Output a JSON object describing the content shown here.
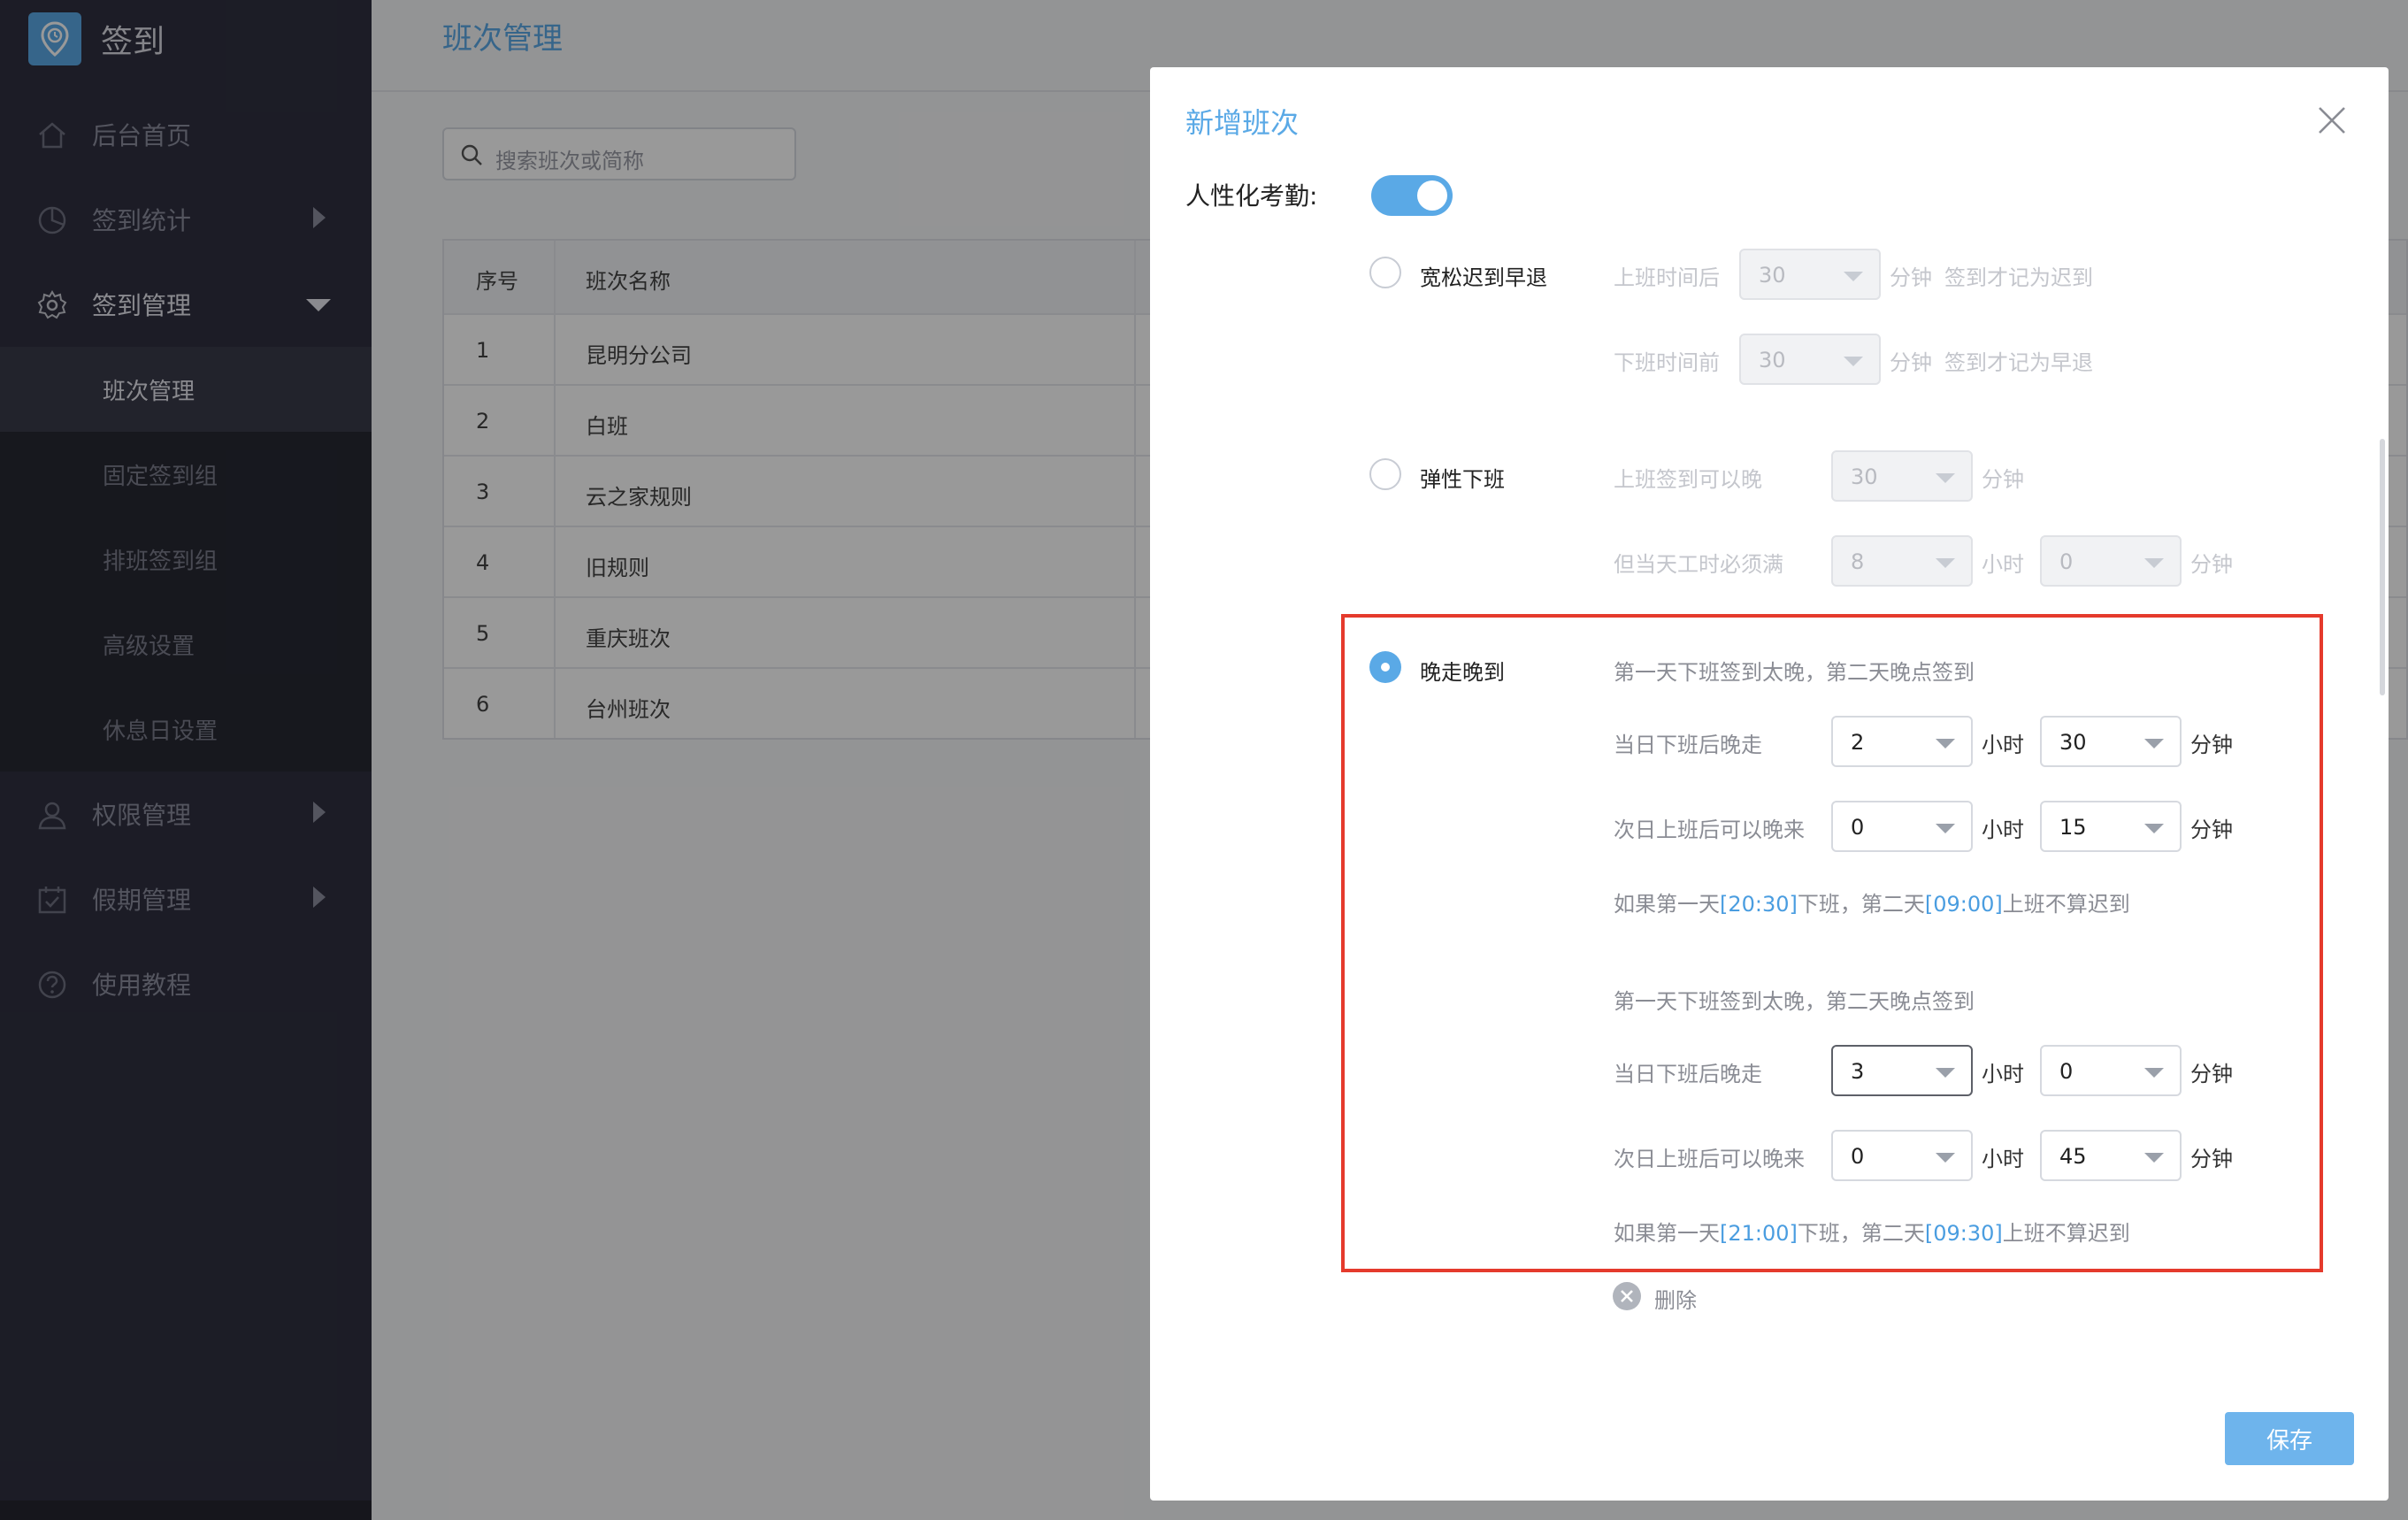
{
  "app": {
    "logo_text": "签到"
  },
  "sidebar": {
    "items": [
      {
        "label": "后台首页",
        "icon": "home-icon"
      },
      {
        "label": "签到统计",
        "icon": "pie-chart-icon"
      },
      {
        "label": "签到管理",
        "icon": "gear-icon"
      },
      {
        "label": "权限管理",
        "icon": "user-icon"
      },
      {
        "label": "假期管理",
        "icon": "calendar-check-icon"
      },
      {
        "label": "使用教程",
        "icon": "help-icon"
      }
    ],
    "submenu": [
      "班次管理",
      "固定签到组",
      "排班签到组",
      "高级设置",
      "休息日设置"
    ]
  },
  "main": {
    "title": "班次管理",
    "search_placeholder": "搜索班次或简称",
    "table": {
      "headers": [
        "序号",
        "班次名称"
      ],
      "rows": [
        [
          "1",
          "昆明分公司"
        ],
        [
          "2",
          "白班"
        ],
        [
          "3",
          "云之家规则"
        ],
        [
          "4",
          "旧规则"
        ],
        [
          "5",
          "重庆班次"
        ],
        [
          "6",
          "台州班次"
        ]
      ]
    }
  },
  "modal": {
    "title": "新增班次",
    "humanized_label": "人性化考勤:",
    "humanized_enabled": true,
    "opt1": {
      "label": "宽松迟到早退",
      "row1": {
        "pre": "上班时间后",
        "value": "30",
        "unit": "分钟",
        "post": "签到才记为迟到"
      },
      "row2": {
        "pre": "下班时间前",
        "value": "30",
        "unit": "分钟",
        "post": "签到才记为早退"
      }
    },
    "opt2": {
      "label": "弹性下班",
      "row1": {
        "pre": "上班签到可以晚",
        "value": "30",
        "unit": "分钟"
      },
      "row2": {
        "pre": "但当天工时必须满",
        "hours": "8",
        "hours_unit": "小时",
        "minutes": "0",
        "minutes_unit": "分钟"
      }
    },
    "opt3": {
      "label": "晚走晚到",
      "rules": [
        {
          "desc": "第一天下班签到太晚，第二天晚点签到",
          "leave_label": "当日下班后晚走",
          "leave_hours": "2",
          "leave_minutes": "30",
          "arrive_label": "次日上班后可以晚来",
          "arrive_hours": "0",
          "arrive_minutes": "15",
          "summary_a": "如果第一天",
          "summary_t1": "[20:30]",
          "summary_b": "下班，第二天",
          "summary_t2": "[09:00]",
          "summary_c": "上班不算迟到"
        },
        {
          "desc": "第一天下班签到太晚，第二天晚点签到",
          "leave_label": "当日下班后晚走",
          "leave_hours": "3",
          "leave_minutes": "0",
          "arrive_label": "次日上班后可以晚来",
          "arrive_hours": "0",
          "arrive_minutes": "45",
          "summary_a": "如果第一天",
          "summary_t1": "[21:00]",
          "summary_b": "下班，第二天",
          "summary_t2": "[09:30]",
          "summary_c": "上班不算迟到"
        }
      ]
    },
    "unit_hour": "小时",
    "unit_minute": "分钟",
    "delete_label": "删除",
    "save_label": "保存"
  },
  "colors": {
    "accent": "#5aa9e6",
    "sidebar": "#2f3040",
    "highlight_box": "#e53a2c"
  }
}
